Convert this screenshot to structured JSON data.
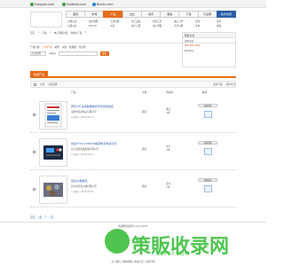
{
  "topbar": {
    "sites": [
      {
        "label": "Diaoyan.com",
        "color": "#3a9e3a"
      },
      {
        "label": "Dudbaiy.com",
        "color": "#3a9e3a"
      },
      {
        "label": "Biezhi.com",
        "color": "#2a7fd4"
      }
    ]
  },
  "nav": {
    "tabs": [
      "首页",
      "市场",
      "产品",
      "企业",
      "资讯",
      "展会",
      "下载",
      "行业网",
      "技术支持"
    ],
    "active_index": 2,
    "blue_index": 8,
    "sub_items": [
      "仪器仪表",
      "电力电器",
      "五金机械",
      "化工设备",
      "机床工具",
      "电子元件",
      "安防",
      "资讯",
      "仪器仪表",
      "DIC/DC",
      "仪表",
      "电子元器",
      "电子测量",
      "光学仪器",
      "光电",
      "电源"
    ]
  },
  "breadcrumb": {
    "items": [
      "首页",
      "产品",
      "电子测量仪器"
    ],
    "hits_label": "约相关产品",
    "hits_value": "3"
  },
  "filter": {
    "label": "产品分类:",
    "options": [
      "全部产品",
      "机柜",
      "仪表",
      "变频器",
      "显示屏"
    ],
    "active_index": 0
  },
  "search": {
    "select_value": "产品名称",
    "button": "搜索",
    "label": "关键词"
  },
  "sidebox": {
    "title": "联系信息",
    "lines": [
      "客服热线",
      "400 052 2000",
      "服务时间"
    ]
  },
  "section": {
    "tab": "热搜产品"
  },
  "toolbar": {
    "items": [
      "全选",
      "对比选择",
      "发布产品",
      "排序方式"
    ]
  },
  "table_head": {
    "columns": [
      "产品",
      "价格",
      "所在地",
      "联系"
    ]
  },
  "products": [
    {
      "title": "研氏1ZJ 在线数据格式声音自动监控",
      "company": "深圳市某某电子有限公司",
      "meta": "产品型号: 2018-03-15",
      "price": "面议",
      "loc_city": "重庆",
      "loc_year": "1年",
      "contact": "在线洽谈"
    },
    {
      "title": "供应57V/120000W极限电流电源可靠",
      "company": "北京某某科技发展有限公司",
      "meta": "产品型号: 2018-03-12",
      "price": "面议",
      "loc_city": "北京",
      "loc_year": "1年",
      "contact": "在线洽谈"
    },
    {
      "title": "供应JIS数据表",
      "company": "苏州市某某仪器有限公司",
      "meta": "产品型号: 2018-03-09",
      "price": "面议",
      "loc_city": "苏州",
      "loc_year": "1年",
      "contact": "在线洽谈"
    }
  ],
  "pager": {
    "items": [
      "首页",
      "上页",
      "1",
      "下页"
    ]
  },
  "footer": {
    "line1": "电通网版权所有 2011-2015",
    "line2": "关于我们 | 网站地图 | 联系方式 | 法律声明"
  },
  "watermark": {
    "text": "策販收录网",
    "url": "CEFSY.COM"
  }
}
